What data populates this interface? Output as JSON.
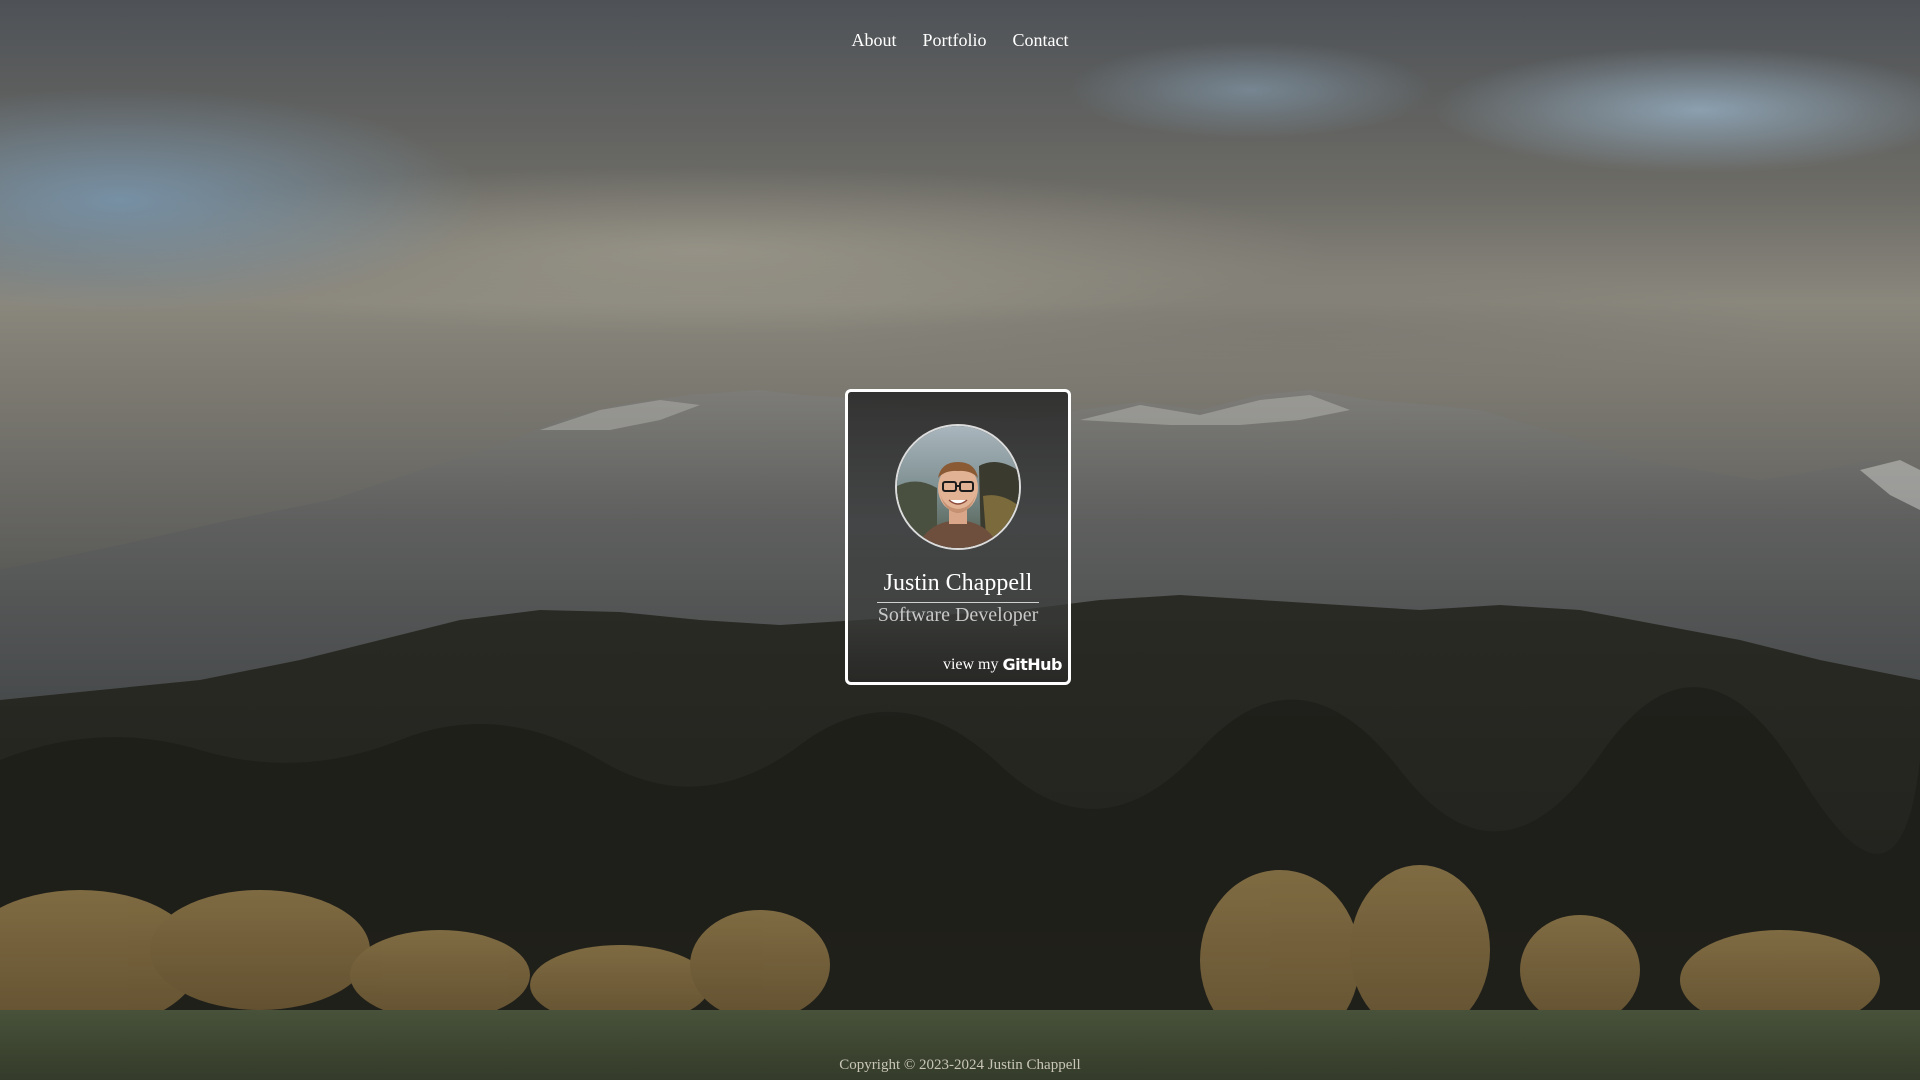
{
  "nav": {
    "items": [
      {
        "label": "About"
      },
      {
        "label": "Portfolio"
      },
      {
        "label": "Contact"
      }
    ]
  },
  "profile": {
    "name": "Justin Chappell",
    "role": "Software Developer",
    "link_prefix": "view my",
    "link_brand": "GitHub"
  },
  "footer": {
    "copyright": "Copyright © 2023-2024 Justin Chappell"
  },
  "icons": {
    "avatar": "profile-photo",
    "github": "github-wordmark"
  }
}
